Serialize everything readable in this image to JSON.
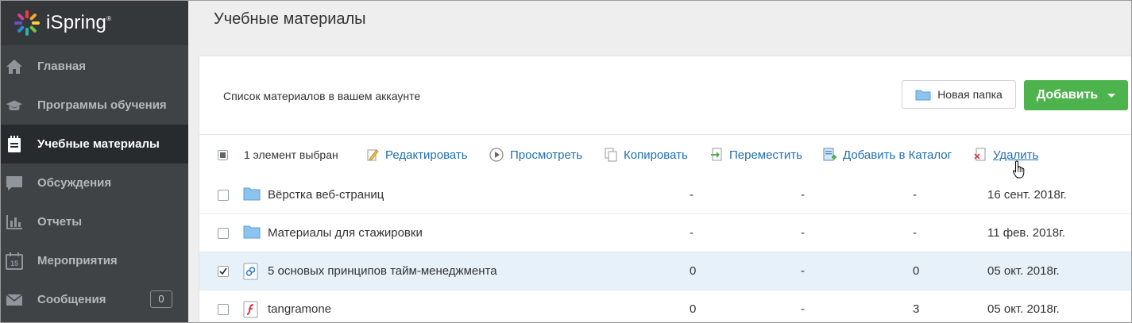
{
  "app": {
    "logo_text": "iSpring"
  },
  "sidebar": {
    "items": [
      {
        "label": "Главная",
        "icon": "home-icon"
      },
      {
        "label": "Программы обучения",
        "icon": "graduation-cap-icon"
      },
      {
        "label": "Учебные материалы",
        "icon": "notebook-icon",
        "active": true
      },
      {
        "label": "Обсуждения",
        "icon": "chat-icon"
      },
      {
        "label": "Отчеты",
        "icon": "bar-chart-icon"
      },
      {
        "label": "Мероприятия",
        "icon": "calendar-icon"
      },
      {
        "label": "Сообщения",
        "icon": "envelope-icon",
        "badge": "0"
      }
    ]
  },
  "main": {
    "title": "Учебные материалы",
    "caption": "Список материалов в вашем аккаунте",
    "new_folder_label": "Новая папка",
    "add_label": "Добавить"
  },
  "toolbar": {
    "selected_text": "1 элемент выбран",
    "edit": "Редактировать",
    "view": "Просмотреть",
    "copy": "Копировать",
    "move": "Переместить",
    "add_to_catalog": "Добавить в Каталог",
    "delete": "Удалить"
  },
  "rows": [
    {
      "name": "Вёрстка веб-страниц",
      "type": "folder",
      "c1": "-",
      "c2": "-",
      "c3": "-",
      "date": "16 сент. 2018г.",
      "checked": false
    },
    {
      "name": "Материалы для стажировки",
      "type": "folder",
      "c1": "-",
      "c2": "-",
      "c3": "-",
      "date": "11 фев. 2018г.",
      "checked": false
    },
    {
      "name": "5 основых принципов тайм-менеджмента",
      "type": "link",
      "c1": "0",
      "c2": "-",
      "c3": "0",
      "date": "05 окт. 2018г.",
      "checked": true
    },
    {
      "name": "tangramone",
      "type": "flash",
      "c1": "0",
      "c2": "-",
      "c3": "3",
      "date": "05 окт. 2018г.",
      "checked": false
    }
  ],
  "colors": {
    "sidebar": "#3f4346",
    "active": "#282b2e",
    "accent_green": "#4db34d",
    "link": "#1f6fb2",
    "selected_row": "#e6f1f9"
  }
}
